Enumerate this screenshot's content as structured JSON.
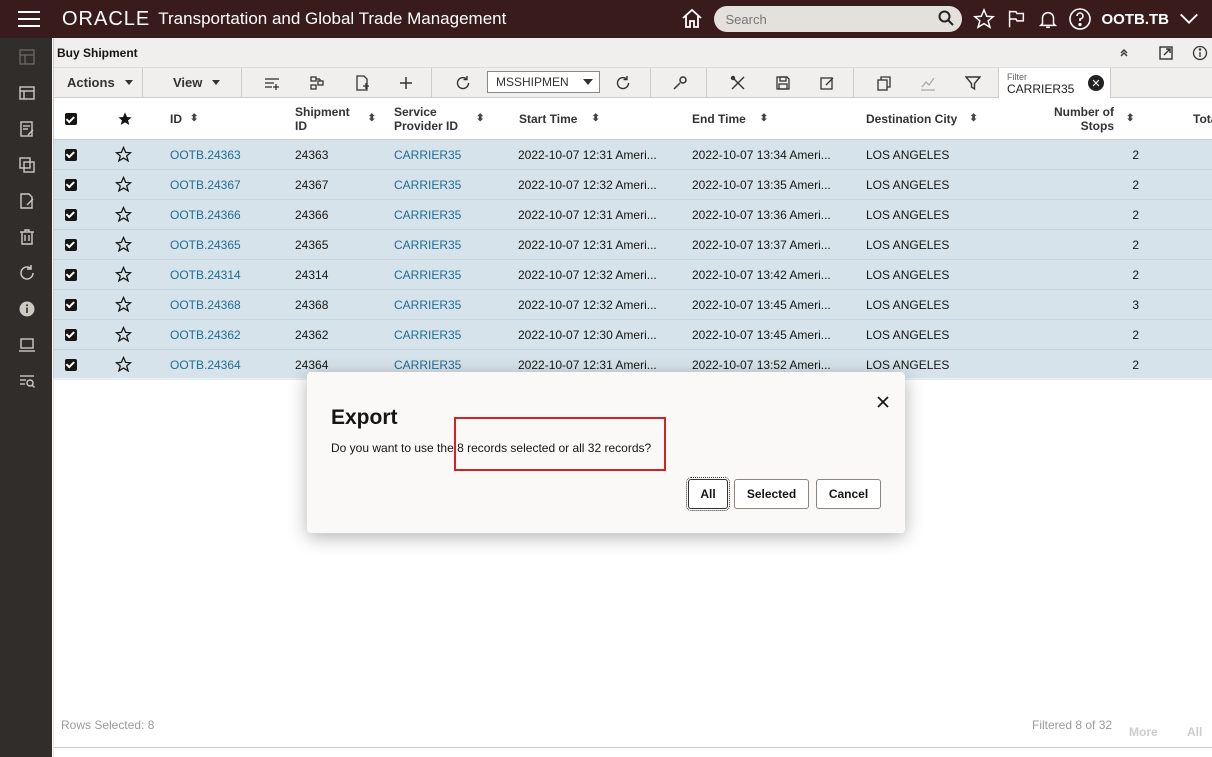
{
  "header": {
    "brand": "ORACLE",
    "product": "Transportation and Global Trade Management",
    "search_placeholder": "Search",
    "user": "OOTB.TB"
  },
  "page": {
    "title": "Buy Shipment"
  },
  "toolbar": {
    "actions_label": "Actions",
    "view_label": "View",
    "saved_query": "MSSHIPMEN",
    "filter_label": "Filter",
    "filter_value": "CARRIER35"
  },
  "table": {
    "columns": {
      "id": "ID",
      "shipment_id_1": "Shipment",
      "shipment_id_2": "ID",
      "provider_1": "Service",
      "provider_2": "Provider ID",
      "start": "Start Time",
      "end": "End Time",
      "dest": "Destination City",
      "stops_1": "Number of",
      "stops_2": "Stops",
      "total": "Tota"
    },
    "rows": [
      {
        "id": "OOTB.24363",
        "shipment_id": "24363",
        "provider": "CARRIER35",
        "start": "2022-10-07 12:31 Ameri...",
        "end": "2022-10-07 13:34 Ameri...",
        "dest": "LOS ANGELES",
        "stops": "2"
      },
      {
        "id": "OOTB.24367",
        "shipment_id": "24367",
        "provider": "CARRIER35",
        "start": "2022-10-07 12:32 Ameri...",
        "end": "2022-10-07 13:35 Ameri...",
        "dest": "LOS ANGELES",
        "stops": "2"
      },
      {
        "id": "OOTB.24366",
        "shipment_id": "24366",
        "provider": "CARRIER35",
        "start": "2022-10-07 12:31 Ameri...",
        "end": "2022-10-07 13:36 Ameri...",
        "dest": "LOS ANGELES",
        "stops": "2"
      },
      {
        "id": "OOTB.24365",
        "shipment_id": "24365",
        "provider": "CARRIER35",
        "start": "2022-10-07 12:31 Ameri...",
        "end": "2022-10-07 13:37 Ameri...",
        "dest": "LOS ANGELES",
        "stops": "2"
      },
      {
        "id": "OOTB.24314",
        "shipment_id": "24314",
        "provider": "CARRIER35",
        "start": "2022-10-07 12:32 Ameri...",
        "end": "2022-10-07 13:42 Ameri...",
        "dest": "LOS ANGELES",
        "stops": "2"
      },
      {
        "id": "OOTB.24368",
        "shipment_id": "24368",
        "provider": "CARRIER35",
        "start": "2022-10-07 12:32 Ameri...",
        "end": "2022-10-07 13:45 Ameri...",
        "dest": "LOS ANGELES",
        "stops": "3"
      },
      {
        "id": "OOTB.24362",
        "shipment_id": "24362",
        "provider": "CARRIER35",
        "start": "2022-10-07 12:30 Ameri...",
        "end": "2022-10-07 13:45 Ameri...",
        "dest": "LOS ANGELES",
        "stops": "2"
      },
      {
        "id": "OOTB.24364",
        "shipment_id": "24364",
        "provider": "CARRIER35",
        "start": "2022-10-07 12:31 Ameri...",
        "end": "2022-10-07 13:52 Ameri...",
        "dest": "LOS ANGELES",
        "stops": "2"
      }
    ]
  },
  "footer": {
    "rows_selected": "Rows Selected: 8",
    "filtered": "Filtered 8 of 32",
    "more": "More",
    "all": "All"
  },
  "dialog": {
    "title": "Export",
    "message": "Do you want to use the 8 records selected or all 32 records?",
    "all_label": "All",
    "selected_label": "Selected",
    "cancel_label": "Cancel"
  },
  "colors": {
    "header_bg": "#3a1b1b",
    "rail_bg": "#312d2a",
    "row_selected_bg": "#d7e3ea",
    "link": "#1f6d94",
    "highlight_box": "#d42323"
  }
}
